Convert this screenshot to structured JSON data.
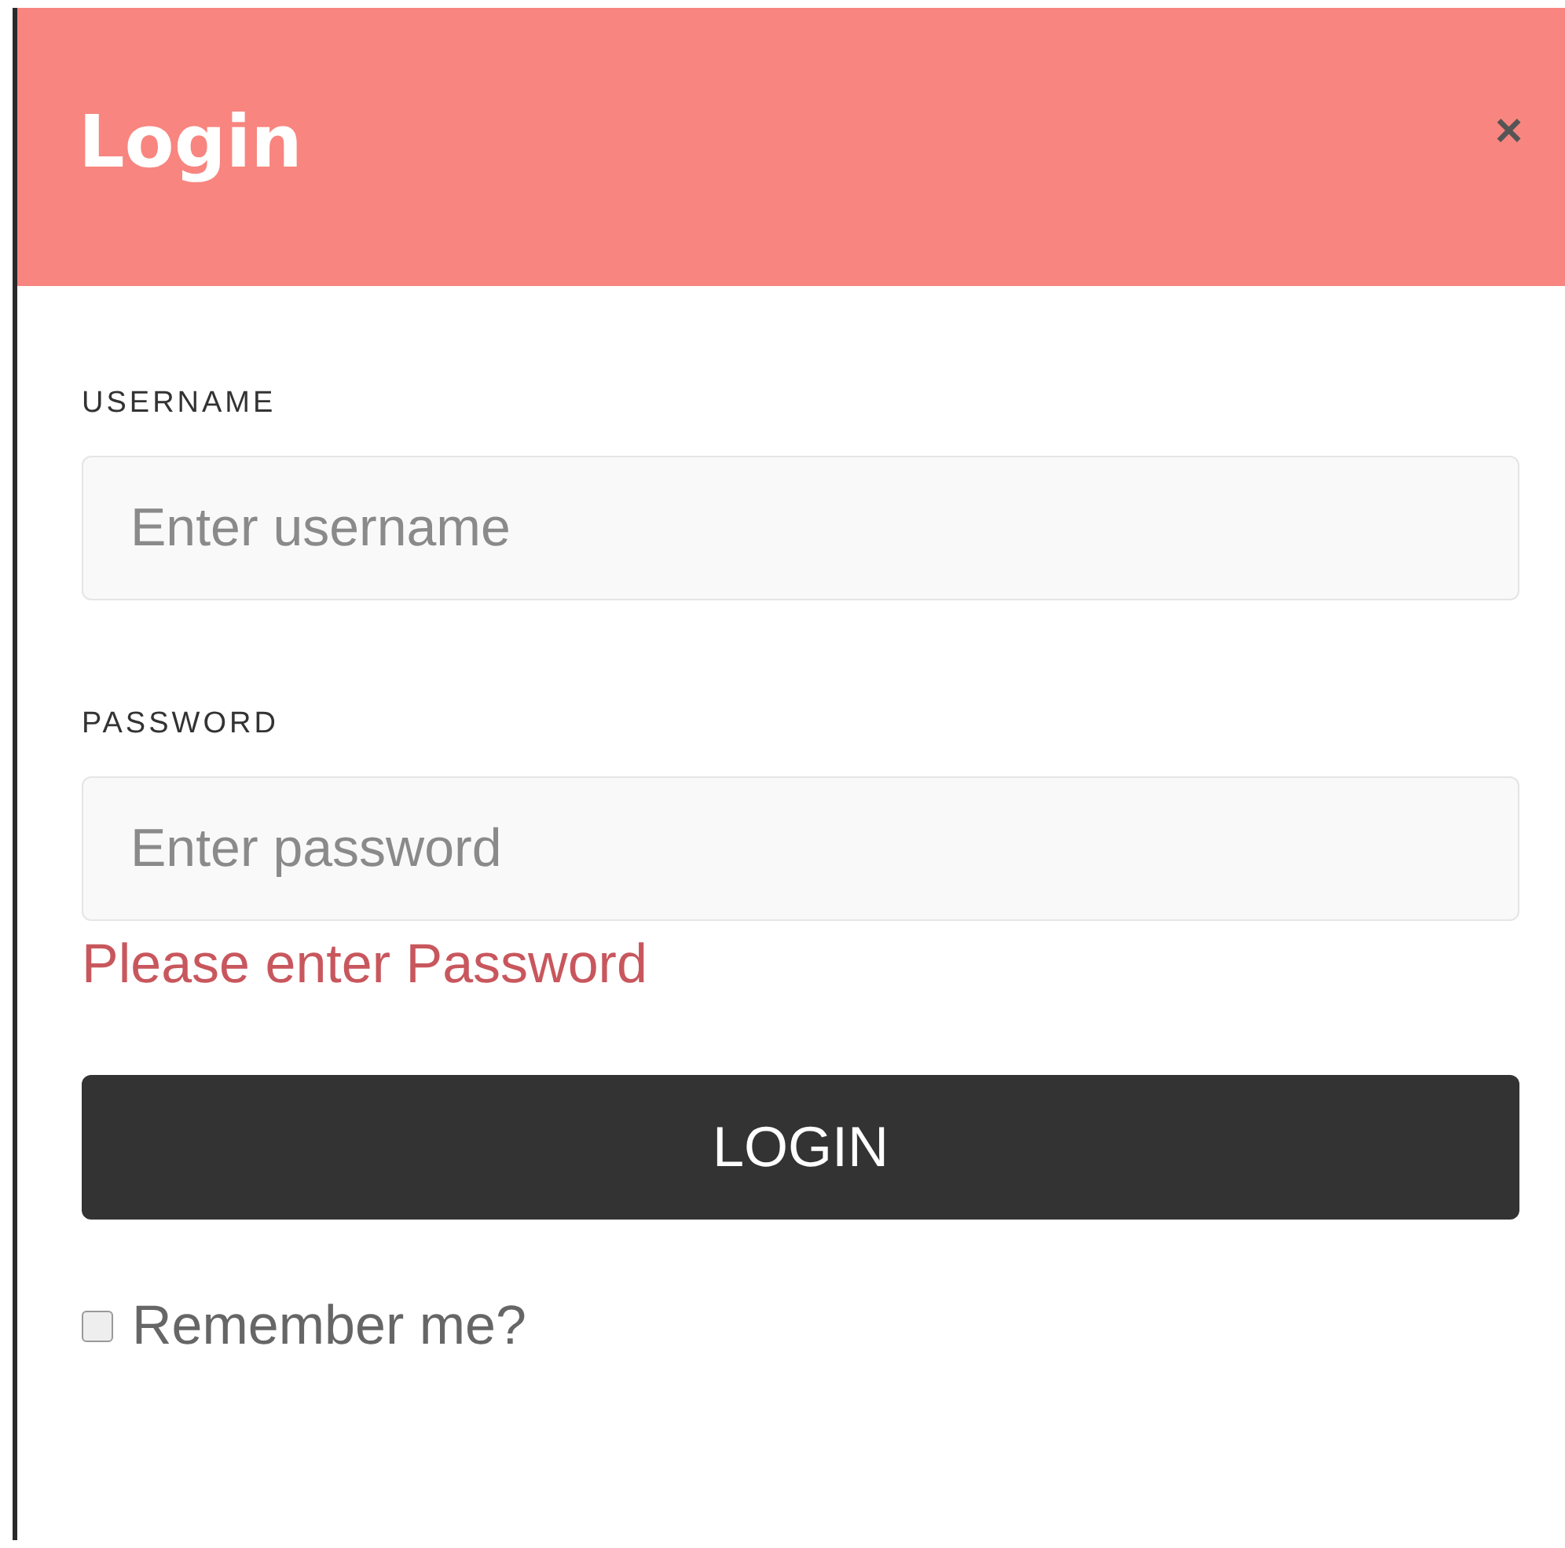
{
  "dialog": {
    "title": "Login",
    "close": "×"
  },
  "fields": [
    {
      "label": "USERNAME",
      "placeholder": "Enter username"
    },
    {
      "label": "PASSWORD",
      "placeholder": "Enter password",
      "error": "Please enter Password"
    }
  ],
  "submit": "LOGIN",
  "remember": {
    "label": "Remember me?",
    "checked": false
  }
}
